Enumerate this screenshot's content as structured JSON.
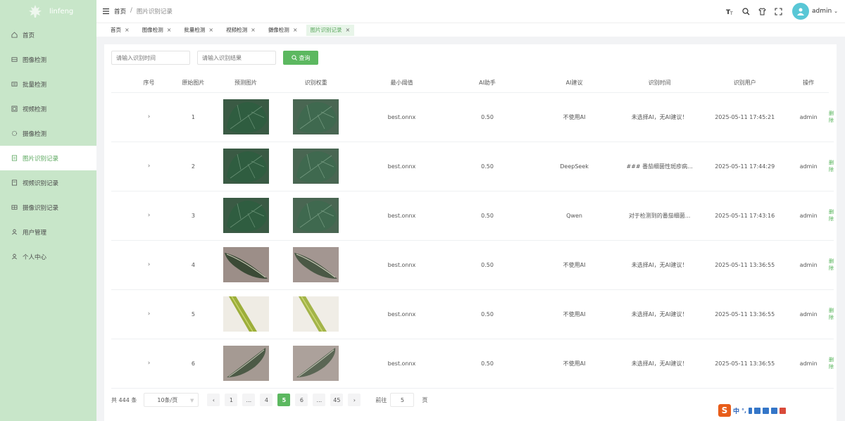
{
  "brand": {
    "name": "linfeng",
    "icon": "maple-leaf-icon"
  },
  "colors": {
    "sidebar_bg": "#c8e6c9",
    "accent": "#5cb860",
    "avatar": "#59c7d6"
  },
  "sidebar": {
    "items": [
      {
        "label": "首页",
        "icon": "home-icon"
      },
      {
        "label": "图像检测",
        "icon": "image-icon"
      },
      {
        "label": "批量检测",
        "icon": "batch-icon"
      },
      {
        "label": "视频检测",
        "icon": "video-icon"
      },
      {
        "label": "摄像检测",
        "icon": "camera-icon"
      },
      {
        "label": "图片识别记录",
        "icon": "record-icon",
        "active": true
      },
      {
        "label": "视频识别记录",
        "icon": "video-record-icon"
      },
      {
        "label": "摄像识别记录",
        "icon": "camera-record-icon"
      },
      {
        "label": "用户管理",
        "icon": "user-icon"
      },
      {
        "label": "个人中心",
        "icon": "person-icon"
      }
    ]
  },
  "header": {
    "breadcrumb": [
      "首页",
      "/",
      "图片识别记录"
    ],
    "username": "admin"
  },
  "tags": [
    {
      "label": "首页"
    },
    {
      "label": "图像检测"
    },
    {
      "label": "批量检测"
    },
    {
      "label": "视频检测"
    },
    {
      "label": "摄像检测"
    },
    {
      "label": "图片识别记录",
      "active": true
    }
  ],
  "search": {
    "time_placeholder": "请输入识别时间",
    "result_placeholder": "请输入识别结果",
    "query_label": "查询"
  },
  "table": {
    "columns": [
      "序号",
      "原始图片",
      "预测图片",
      "识别权重",
      "最小阈值",
      "AI助手",
      "AI建议",
      "识别时间",
      "识别用户",
      "操作"
    ],
    "rows": [
      {
        "index": "1",
        "weight": "best.onnx",
        "threshold": "0.50",
        "assistant": "不使用AI",
        "advice": "未选择AI，无AI建议！",
        "time": "2025-05-11 17:45:21",
        "user": "admin",
        "action": "删除",
        "image": "leaf-a"
      },
      {
        "index": "2",
        "weight": "best.onnx",
        "threshold": "0.50",
        "assistant": "DeepSeek",
        "advice": "### 番茄细菌性斑疹病...",
        "time": "2025-05-11 17:44:29",
        "user": "admin",
        "action": "删除",
        "image": "leaf-a"
      },
      {
        "index": "3",
        "weight": "best.onnx",
        "threshold": "0.50",
        "assistant": "Qwen",
        "advice": "对于检测到的番茄细菌...",
        "time": "2025-05-11 17:43:16",
        "user": "admin",
        "action": "删除",
        "image": "leaf-a"
      },
      {
        "index": "4",
        "weight": "best.onnx",
        "threshold": "0.50",
        "assistant": "不使用AI",
        "advice": "未选择AI，无AI建议！",
        "time": "2025-05-11 13:36:55",
        "user": "admin",
        "action": "删除",
        "image": "leaf-b"
      },
      {
        "index": "5",
        "weight": "best.onnx",
        "threshold": "0.50",
        "assistant": "不使用AI",
        "advice": "未选择AI，无AI建议！",
        "time": "2025-05-11 13:36:55",
        "user": "admin",
        "action": "删除",
        "image": "stem"
      },
      {
        "index": "6",
        "weight": "best.onnx",
        "threshold": "0.50",
        "assistant": "不使用AI",
        "advice": "未选择AI，无AI建议！",
        "time": "2025-05-11 13:36:55",
        "user": "admin",
        "action": "删除",
        "image": "leaf-c"
      }
    ]
  },
  "pagination": {
    "total_text": "共 444 条",
    "page_size": "10条/页",
    "pages": [
      "1",
      "...",
      "4",
      "5",
      "6",
      "...",
      "45"
    ],
    "current": "5",
    "goto_label": "前往",
    "goto_value": "5",
    "page_suffix": "页"
  },
  "ime": {
    "label": "中"
  }
}
